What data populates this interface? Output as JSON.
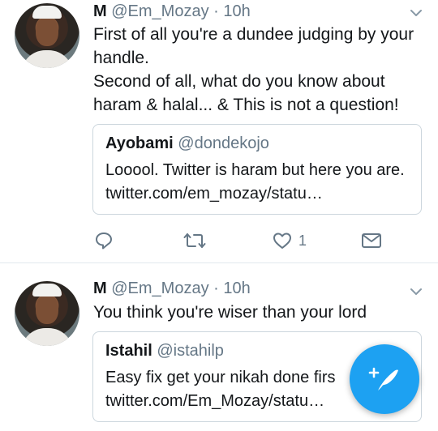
{
  "tweets": [
    {
      "author_name": "M",
      "author_handle": "@Em_Mozay",
      "separator": "·",
      "time": "10h",
      "text_lines": [
        "First of all you're a dundee judging by your handle.",
        "Second of all, what do you know about haram & halal... & This is not a question!"
      ],
      "quoted": {
        "name": "Ayobami",
        "handle": "@dondekojo",
        "text": "Looool. Twitter is haram but here you are. twitter.com/em_mozay/statu…"
      },
      "actions": {
        "reply_icon": "reply-icon",
        "retweet_icon": "retweet-icon",
        "like_icon": "heart-icon",
        "like_count": "1",
        "message_icon": "envelope-icon"
      }
    },
    {
      "author_name": "M",
      "author_handle": "@Em_Mozay",
      "separator": "·",
      "time": "10h",
      "text_lines": [
        "You think you're wiser than your lord"
      ],
      "quoted": {
        "name": "Istahil",
        "handle": "@istahilp",
        "text_line1": "Easy fix get your nikah done firs",
        "text_line2": "twitter.com/Em_Mozay/statu…"
      }
    }
  ],
  "fab": {
    "icon": "compose-tweet-icon",
    "color": "#1da1f2"
  },
  "colors": {
    "muted": "#657786",
    "border": "#ccd6dd",
    "accent": "#1da1f2"
  }
}
